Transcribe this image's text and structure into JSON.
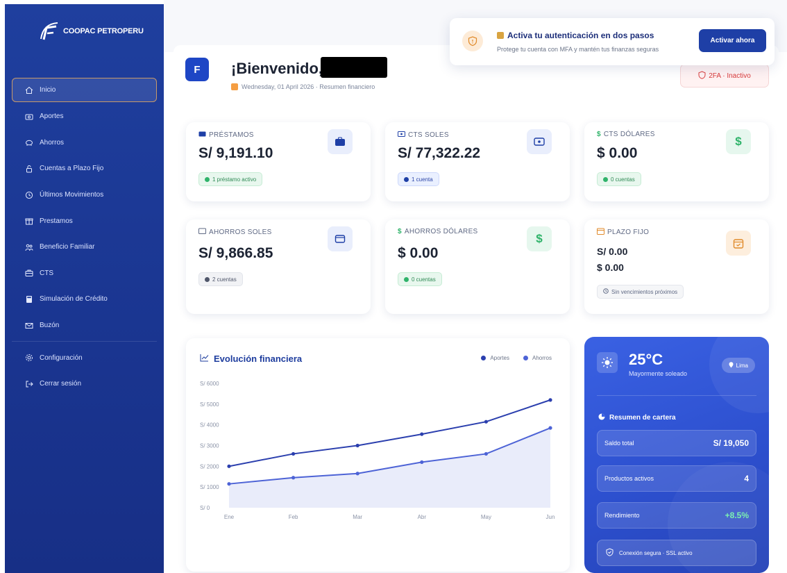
{
  "brand": {
    "name": "COOPAC PETROPERU"
  },
  "sidebar": {
    "items": [
      {
        "label": "Inicio",
        "icon": "home-icon"
      },
      {
        "label": "Aportes",
        "icon": "wallet-icon"
      },
      {
        "label": "Ahorros",
        "icon": "piggy-bank-icon"
      },
      {
        "label": "Cuentas a Plazo Fijo",
        "icon": "lock-icon"
      },
      {
        "label": "Últimos Movimientos",
        "icon": "clock-icon"
      },
      {
        "label": "Prestamos",
        "icon": "gift-icon"
      },
      {
        "label": "Beneficio Familiar",
        "icon": "family-icon"
      },
      {
        "label": "CTS",
        "icon": "briefcase-icon"
      },
      {
        "label": "Simulación de Crédito",
        "icon": "calculator-icon"
      },
      {
        "label": "Buzón",
        "icon": "mail-icon"
      },
      {
        "label": "Configuración",
        "icon": "gear-icon"
      },
      {
        "label": "Cerrar sesión",
        "icon": "logout-icon"
      }
    ]
  },
  "header": {
    "avatar_letter": "F",
    "welcome": "¡Bienvenido,",
    "date_line": "Wednesday, 01 April 2026 · Resumen financiero",
    "twofa_status": "2FA · Inactivo"
  },
  "toast": {
    "title": "Activa tu autenticación en dos pasos",
    "subtitle": "Protege tu cuenta con MFA y mantén tus finanzas seguras",
    "button": "Activar ahora"
  },
  "cards": {
    "prestamos": {
      "label": "PRÉSTAMOS",
      "value": "S/ 9,191.10",
      "pill": "1 préstamo activo"
    },
    "cts_soles": {
      "label": "CTS SOLES",
      "value": "S/ 77,322.22",
      "pill": "1 cuenta"
    },
    "cts_dolares": {
      "label": "CTS DÓLARES",
      "value": "$ 0.00",
      "pill": "0 cuentas"
    },
    "ahorros_soles": {
      "label": "AHORROS SOLES",
      "value": "S/ 9,866.85",
      "pill": "2 cuentas"
    },
    "ahorros_dolares": {
      "label": "AHORROS DÓLARES",
      "value": "$ 0.00",
      "pill": "0 cuentas"
    },
    "plazo_fijo": {
      "label": "PLAZO FIJO",
      "value_soles": "S/ 0.00",
      "value_dolares": "$ 0.00",
      "pill": "Sin vencimientos próximos"
    }
  },
  "colors": {
    "sidebar": "#1f3f9e",
    "accent": "#1e3fa6",
    "aportes": "#2b3fae",
    "ahorros": "#4d63d6",
    "success": "#2fb36a",
    "danger": "#d93a3a"
  },
  "chart_data": {
    "type": "line",
    "title": "Evolución financiera",
    "categories": [
      "Ene",
      "Feb",
      "Mar",
      "Abr",
      "May",
      "Jun"
    ],
    "series": [
      {
        "name": "Aportes",
        "values": [
          2000,
          2600,
          3000,
          3550,
          4150,
          5200
        ]
      },
      {
        "name": "Ahorros",
        "values": [
          1150,
          1450,
          1650,
          2200,
          2600,
          3850
        ]
      }
    ],
    "yticks": [
      "S/ 0",
      "S/ 1000",
      "S/ 2000",
      "S/ 3000",
      "S/ 4000",
      "S/ 5000",
      "S/ 6000"
    ],
    "ylim": [
      0,
      6000
    ],
    "legend_position": "top-right",
    "grid": false
  },
  "weather": {
    "temp": "25°C",
    "desc": "Mayormente soleado",
    "city": "Lima"
  },
  "portfolio": {
    "title": "Resumen de cartera",
    "rows": [
      {
        "label": "Saldo total",
        "value": "S/ 19,050"
      },
      {
        "label": "Productos activos",
        "value": "4"
      },
      {
        "label": "Rendimiento",
        "value": "+8.5%"
      }
    ],
    "ssl": "Conexión segura · SSL activo"
  }
}
